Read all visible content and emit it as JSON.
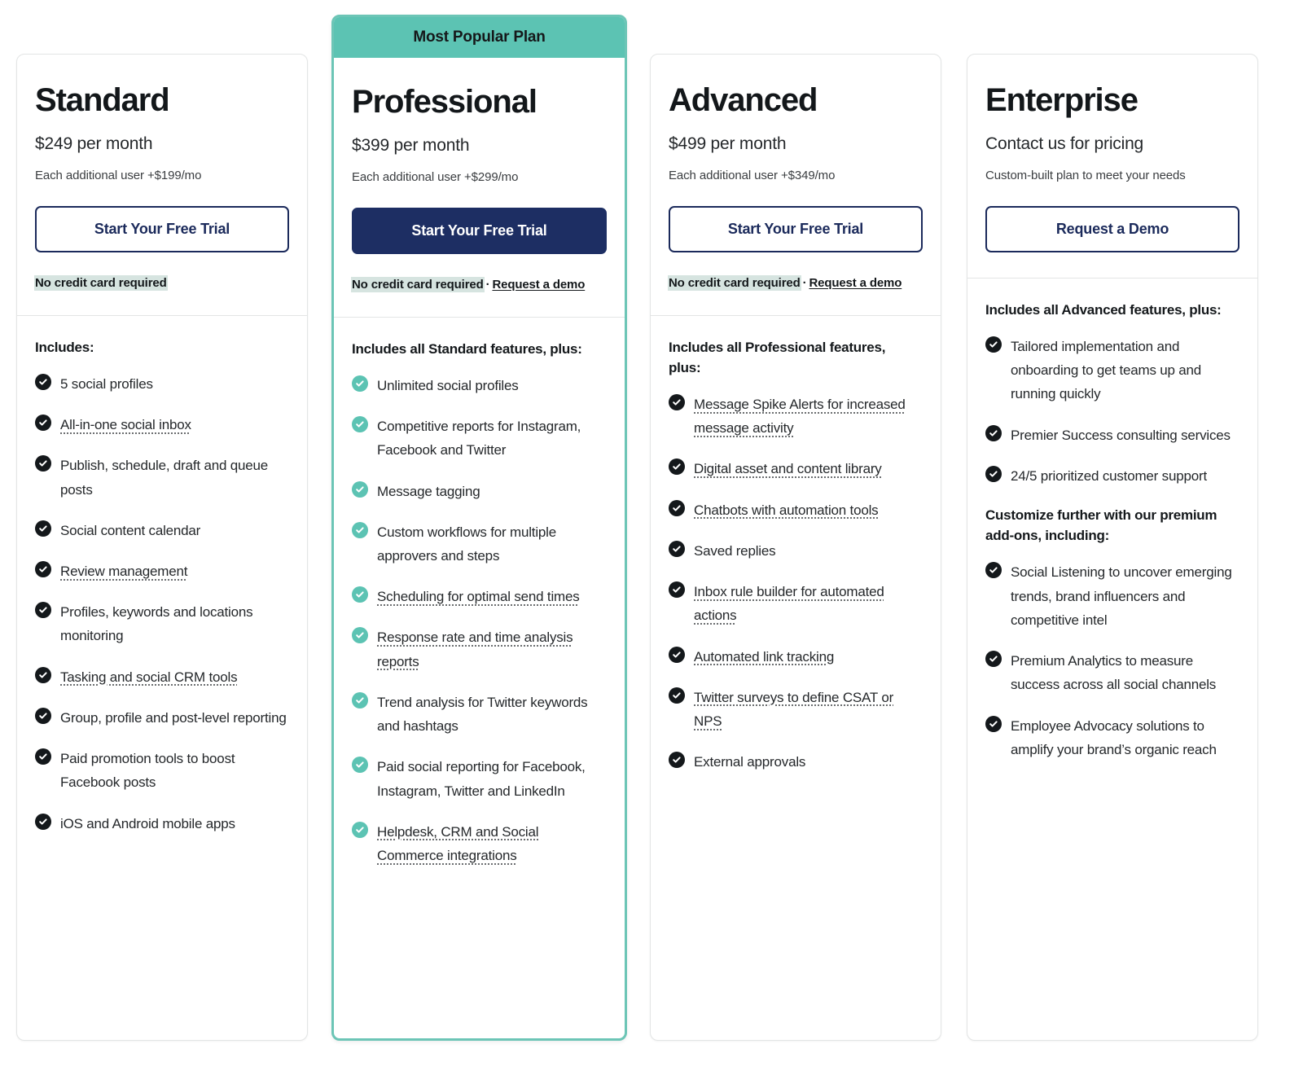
{
  "colors": {
    "accent_teal": "#5cc3b3",
    "cta_navy": "#1d2e63",
    "highlight_sage": "#d6e4e0",
    "card_border": "#e3e5e5",
    "text_dark": "#14181b"
  },
  "plans": [
    {
      "id": "standard",
      "name": "Standard",
      "price": "$249 per month",
      "additional_user": "Each additional user +$199/mo",
      "cta_label": "Start Your Free Trial",
      "cta_style": "outline",
      "featured": false,
      "banner": null,
      "trial_note": "No credit card required",
      "demo_separator": null,
      "demo_link": null,
      "check_style": "dark",
      "features_title": "Includes:",
      "features": [
        {
          "text": "5 social profiles",
          "tooltip": false
        },
        {
          "text": "All-in-one social inbox",
          "tooltip": true
        },
        {
          "text": "Publish, schedule, draft and queue posts",
          "tooltip": false
        },
        {
          "text": "Social content calendar",
          "tooltip": false
        },
        {
          "text": "Review management",
          "tooltip": true
        },
        {
          "text": "Profiles, keywords and locations monitoring",
          "tooltip": false
        },
        {
          "text": "Tasking and social CRM tools",
          "tooltip": true
        },
        {
          "text": "Group, profile and post-level reporting",
          "tooltip": false
        },
        {
          "text": "Paid promotion tools to boost Facebook posts",
          "tooltip": false
        },
        {
          "text": "iOS and Android mobile apps",
          "tooltip": false
        }
      ],
      "addons_title": null,
      "addons": []
    },
    {
      "id": "professional",
      "name": "Professional",
      "price": "$399 per month",
      "additional_user": "Each additional user +$299/mo",
      "cta_label": "Start Your Free Trial",
      "cta_style": "solid",
      "featured": true,
      "banner": "Most Popular Plan",
      "trial_note": "No credit card required",
      "demo_separator": "·",
      "demo_link": "Request a demo",
      "check_style": "teal",
      "features_title": "Includes all Standard features, plus:",
      "features": [
        {
          "text": "Unlimited social profiles",
          "tooltip": false
        },
        {
          "text": "Competitive reports for Instagram, Facebook and Twitter",
          "tooltip": false
        },
        {
          "text": "Message tagging",
          "tooltip": false
        },
        {
          "text": "Custom workflows for multiple approvers and steps",
          "tooltip": false
        },
        {
          "text": "Scheduling for optimal send times",
          "tooltip": true
        },
        {
          "text": "Response rate and time analysis reports",
          "tooltip": true
        },
        {
          "text": "Trend analysis for Twitter keywords and hashtags",
          "tooltip": false
        },
        {
          "text": "Paid social reporting for Facebook, Instagram, Twitter and LinkedIn",
          "tooltip": false
        },
        {
          "text": "Helpdesk, CRM and Social Commerce integrations",
          "tooltip": true
        }
      ],
      "addons_title": null,
      "addons": []
    },
    {
      "id": "advanced",
      "name": "Advanced",
      "price": "$499 per month",
      "additional_user": "Each additional user +$349/mo",
      "cta_label": "Start Your Free Trial",
      "cta_style": "outline",
      "featured": false,
      "banner": null,
      "trial_note": "No credit card required",
      "demo_separator": "·",
      "demo_link": "Request a demo",
      "check_style": "dark",
      "features_title": "Includes all Professional features, plus:",
      "features": [
        {
          "text": "Message Spike Alerts for increased message activity",
          "tooltip": true
        },
        {
          "text": "Digital asset and content library",
          "tooltip": true
        },
        {
          "text": "Chatbots with automation tools",
          "tooltip": true
        },
        {
          "text": "Saved replies",
          "tooltip": false
        },
        {
          "text": "Inbox rule builder for automated actions",
          "tooltip": true
        },
        {
          "text": "Automated link tracking",
          "tooltip": true
        },
        {
          "text": "Twitter surveys to define CSAT or NPS",
          "tooltip": true
        },
        {
          "text": "External approvals",
          "tooltip": false
        }
      ],
      "addons_title": null,
      "addons": []
    },
    {
      "id": "enterprise",
      "name": "Enterprise",
      "price": "Contact us for pricing",
      "additional_user": "Custom-built plan to meet your needs",
      "cta_label": "Request a Demo",
      "cta_style": "outline",
      "featured": false,
      "banner": null,
      "trial_note": null,
      "demo_separator": null,
      "demo_link": null,
      "check_style": "dark",
      "features_title": "Includes all Advanced features, plus:",
      "features": [
        {
          "text": "Tailored implementation and onboarding to get teams up and running quickly",
          "tooltip": false
        },
        {
          "text": "Premier Success consulting services",
          "tooltip": false
        },
        {
          "text": "24/5 prioritized customer support",
          "tooltip": false
        }
      ],
      "addons_title": "Customize further with our premium add-ons, including:",
      "addons": [
        {
          "text": "Social Listening to uncover emerging trends, brand influencers and competitive intel",
          "tooltip": false
        },
        {
          "text": "Premium Analytics to measure success across all social channels",
          "tooltip": false
        },
        {
          "text": "Employee Advocacy solutions to amplify your brand’s organic reach",
          "tooltip": false
        }
      ]
    }
  ]
}
